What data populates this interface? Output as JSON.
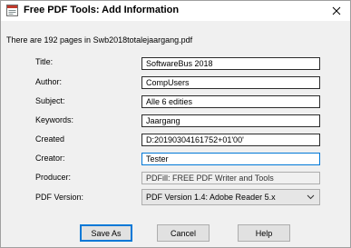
{
  "window": {
    "title": "Free PDF Tools: Add Information",
    "icon": "pdf-app-icon",
    "close_icon": "close-icon"
  },
  "info_text": "There are 192 pages in Swb2018totalejaargang.pdf",
  "fields": {
    "title": {
      "label": "Title:",
      "value": "SoftwareBus 2018"
    },
    "author": {
      "label": "Author:",
      "value": "CompUsers"
    },
    "subject": {
      "label": "Subject:",
      "value": "Alle 6 edities"
    },
    "keywords": {
      "label": "Keywords:",
      "value": "Jaargang"
    },
    "created": {
      "label": "Created",
      "value": "D:20190304161752+01'00'"
    },
    "creator": {
      "label": "Creator:",
      "value": "Tester"
    },
    "producer": {
      "label": "Producer:",
      "value": "PDFill: FREE PDF Writer and Tools"
    },
    "pdf_version": {
      "label": "PDF Version:",
      "value": "PDF Version 1.4: Adobe Reader 5.x"
    }
  },
  "buttons": {
    "save_as": "Save As",
    "cancel": "Cancel",
    "help": "Help"
  },
  "colors": {
    "focus_border": "#0078d7",
    "button_face": "#e1e1e1",
    "dialog_bg": "#f0f0f0"
  }
}
